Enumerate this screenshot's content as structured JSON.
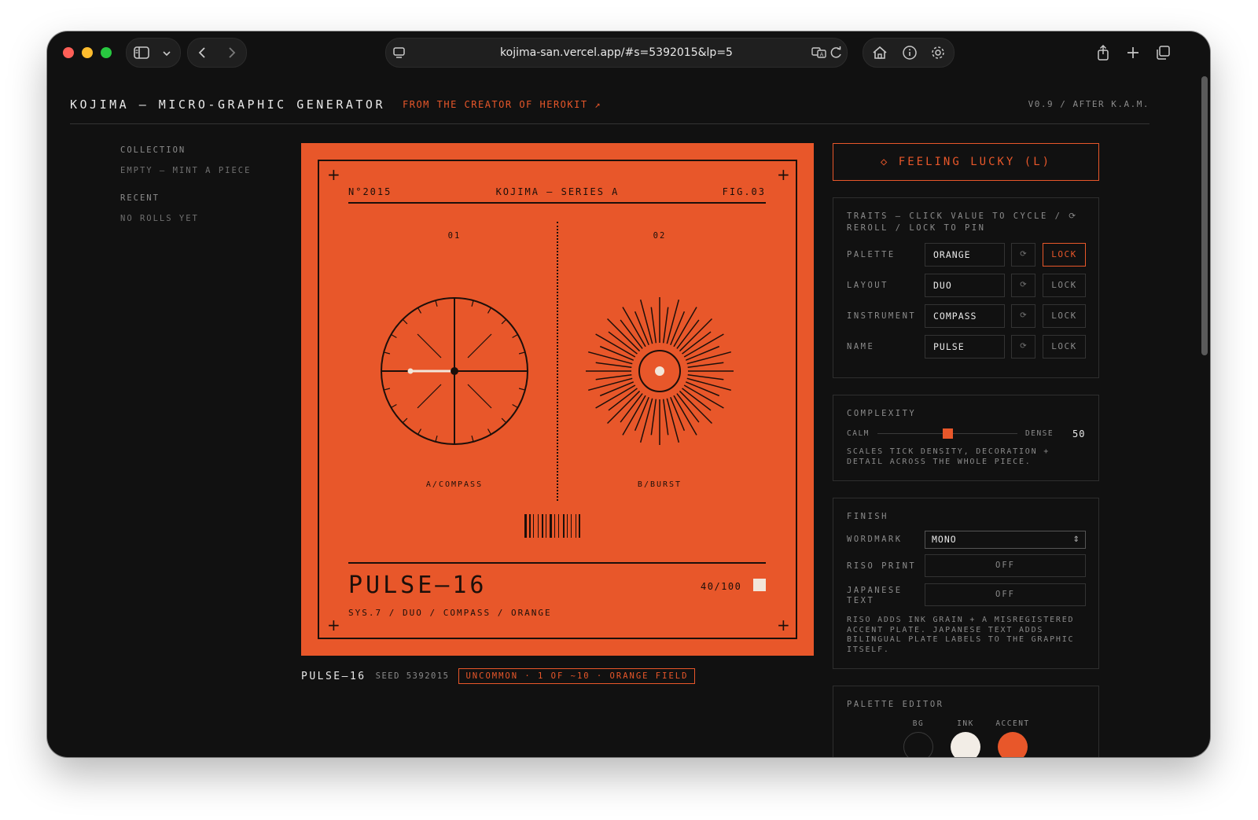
{
  "browser": {
    "url": "kojima-san.vercel.app/#s=5392015&lp=5"
  },
  "app": {
    "title": "KOJIMA — MICRO-GRAPHIC GENERATOR",
    "subtitle_link": "FROM THE CREATOR OF HEROKIT ↗",
    "version": "V0.9 / AFTER K.A.M."
  },
  "sidebar": {
    "collection_label": "COLLECTION",
    "collection_value": "EMPTY — MINT A PIECE",
    "recent_label": "RECENT",
    "recent_value": "NO ROLLS YET"
  },
  "artwork": {
    "number": "N°2015",
    "series": "KOJIMA — SERIES A",
    "fig": "FIG.03",
    "slot1_index": "01",
    "slot2_index": "02",
    "slot1_label": "A/COMPASS",
    "slot2_label": "B/BURST",
    "name": "PULSE—16",
    "count": "40/100",
    "meta": "SYS.7 / DUO / COMPASS / ORANGE",
    "colors": {
      "bg": "#e8572a",
      "ink": "#1c0f0a",
      "accent": "#f2e6d9"
    }
  },
  "caption": {
    "name": "PULSE—16",
    "seed": "SEED 5392015",
    "rarity": "UNCOMMON · 1 OF ~10 · ORANGE FIELD"
  },
  "feeling_lucky": "◇ FEELING LUCKY (L)",
  "traits": {
    "title": "TRAITS — CLICK VALUE TO CYCLE / ⟳ REROLL / LOCK TO PIN",
    "reroll_glyph": "⟳",
    "lock_label": "LOCK",
    "rows": [
      {
        "label": "PALETTE",
        "value": "ORANGE",
        "locked": true
      },
      {
        "label": "LAYOUT",
        "value": "DUO",
        "locked": false
      },
      {
        "label": "INSTRUMENT",
        "value": "COMPASS",
        "locked": false
      },
      {
        "label": "NAME",
        "value": "PULSE",
        "locked": false
      }
    ]
  },
  "complexity": {
    "title": "COMPLEXITY",
    "min_label": "CALM",
    "max_label": "DENSE",
    "value": "50",
    "fraction": 0.5,
    "note": "SCALES TICK DENSITY, DECORATION + DETAIL ACROSS THE WHOLE PIECE."
  },
  "finish": {
    "title": "FINISH",
    "wordmark_label": "WORDMARK",
    "wordmark_value": "MONO",
    "riso_label": "RISO PRINT",
    "riso_value": "OFF",
    "japanese_label": "JAPANESE TEXT",
    "japanese_value": "OFF",
    "note": "RISO ADDS INK GRAIN + A MISREGISTERED ACCENT PLATE. JAPANESE TEXT ADDS BILINGUAL PLATE LABELS TO THE GRAPHIC ITSELF."
  },
  "palette_editor": {
    "title": "PALETTE EDITOR",
    "swatches": [
      {
        "label": "BG",
        "color": "#111111"
      },
      {
        "label": "INK",
        "color": "#f2ede6"
      },
      {
        "label": "ACCENT",
        "color": "#e8572a"
      }
    ]
  }
}
